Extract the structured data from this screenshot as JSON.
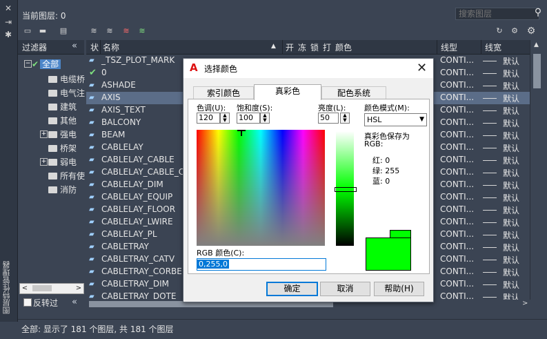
{
  "sidebar_title": "图层特性管理器",
  "header": {
    "current_layer": "当前图层: 0",
    "search_placeholder": "搜索图层"
  },
  "filters": {
    "title": "过滤器",
    "collapse": "«",
    "tree": [
      {
        "label": "全部",
        "selected": true
      },
      {
        "label": "电缆桥"
      },
      {
        "label": "电气注"
      },
      {
        "label": "建筑"
      },
      {
        "label": "其他"
      },
      {
        "label": "强电"
      },
      {
        "label": "桥架"
      },
      {
        "label": "弱电"
      },
      {
        "label": "所有使"
      },
      {
        "label": "消防"
      }
    ],
    "invert_label": "反转过"
  },
  "columns": [
    "状",
    "名称",
    "开",
    "冻",
    "锁",
    "打",
    "颜色",
    "线型",
    "线宽"
  ],
  "layers": [
    {
      "name": "_TSZ_PLOT_MARK",
      "linetype": "CONTI...",
      "lineweight": "默认"
    },
    {
      "name": "0",
      "linetype": "CONTI...",
      "lineweight": "默认",
      "current": true
    },
    {
      "name": "ASHADE",
      "linetype": "CONTI...",
      "lineweight": "默认"
    },
    {
      "name": "AXIS",
      "linetype": "CONTI...",
      "lineweight": "默认",
      "selected": true
    },
    {
      "name": "AXIS_TEXT",
      "linetype": "CONTI...",
      "lineweight": "默认"
    },
    {
      "name": "BALCONY",
      "linetype": "CONTI...",
      "lineweight": "默认"
    },
    {
      "name": "BEAM",
      "linetype": "CONTI...",
      "lineweight": "默认"
    },
    {
      "name": "CABLELAY",
      "linetype": "CONTI...",
      "lineweight": "默认"
    },
    {
      "name": "CABLELAY_CABLE",
      "linetype": "CONTI...",
      "lineweight": "默认"
    },
    {
      "name": "CABLELAY_CABLE_CO",
      "linetype": "CONTI...",
      "lineweight": "默认"
    },
    {
      "name": "CABLELAY_DIM",
      "linetype": "CONTI...",
      "lineweight": "默认"
    },
    {
      "name": "CABLELAY_EQUIP",
      "linetype": "CONTI...",
      "lineweight": "默认"
    },
    {
      "name": "CABLELAY_FLOOR",
      "linetype": "CONTI...",
      "lineweight": "默认"
    },
    {
      "name": "CABLELAY_LWIRE",
      "linetype": "CONTI...",
      "lineweight": "默认"
    },
    {
      "name": "CABLELAY_PL",
      "linetype": "CONTI...",
      "lineweight": "默认"
    },
    {
      "name": "CABLETRAY",
      "linetype": "CONTI...",
      "lineweight": "默认"
    },
    {
      "name": "CABLETRAY_CATV",
      "linetype": "CONTI...",
      "lineweight": "默认"
    },
    {
      "name": "CABLETRAY_CORBEL",
      "linetype": "CONTI...",
      "lineweight": "默认"
    },
    {
      "name": "CABLETRAY_DIM",
      "linetype": "CONTI...",
      "lineweight": "默认"
    },
    {
      "name": "CABLETRAY_DOTE",
      "linetype": "CONTI...",
      "lineweight": "默认"
    }
  ],
  "status": "全部: 显示了 181 个图层, 共 181 个图层",
  "dialog": {
    "title": "选择颜色",
    "tabs": [
      "索引颜色",
      "真彩色",
      "配色系统"
    ],
    "active_tab": 1,
    "hue_label": "色调(U):",
    "hue_value": "120",
    "sat_label": "饱和度(S):",
    "sat_value": "100",
    "lum_label": "亮度(L):",
    "lum_value": "50",
    "mode_label": "颜色模式(M):",
    "mode_value": "HSL",
    "save_as": "真彩色保存为",
    "rgb_colon": "RGB:",
    "red": "红:  0",
    "green": "绿:  255",
    "blue": "蓝:  0",
    "rgb_color_label": "RGB 颜色(C):",
    "rgb_value": "0,255,0",
    "preview_color": "#00ff00",
    "buttons": {
      "ok": "确定",
      "cancel": "取消",
      "help": "帮助(H)"
    }
  }
}
